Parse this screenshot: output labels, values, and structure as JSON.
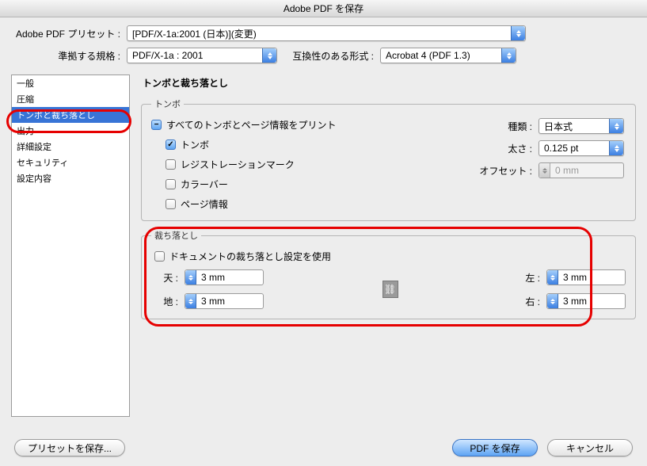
{
  "title": "Adobe PDF を保存",
  "header": {
    "presetLabel": "Adobe PDF プリセット :",
    "presetValue": "[PDF/X-1a:2001 (日本)](変更)",
    "standardLabel": "準拠する規格 :",
    "standardValue": "PDF/X-1a : 2001",
    "compatLabel": "互換性のある形式 :",
    "compatValue": "Acrobat 4 (PDF 1.3)"
  },
  "sidebar": {
    "items": [
      "一般",
      "圧縮",
      "トンボと裁ち落とし",
      "出力",
      "詳細設定",
      "セキュリティ",
      "設定内容"
    ],
    "selectedIndex": 2
  },
  "panel": {
    "heading": "トンボと裁ち落とし",
    "marks": {
      "legend": "トンボ",
      "printAll": "すべてのトンボとページ情報をプリント",
      "trim": "トンボ",
      "registration": "レジストレーションマーク",
      "colorBars": "カラーバー",
      "pageInfo": "ページ情報",
      "typeLabel": "種類 :",
      "typeValue": "日本式",
      "weightLabel": "太さ :",
      "weightValue": "0.125 pt",
      "offsetLabel": "オフセット :",
      "offsetValue": "0 mm"
    },
    "bleed": {
      "legend": "裁ち落とし",
      "useDoc": "ドキュメントの裁ち落とし設定を使用",
      "topLabel": "天 :",
      "bottomLabel": "地 :",
      "leftLabel": "左 :",
      "rightLabel": "右 :",
      "top": "3 mm",
      "bottom": "3 mm",
      "left": "3 mm",
      "right": "3 mm"
    }
  },
  "footer": {
    "savePreset": "プリセットを保存...",
    "savePDF": "PDF を保存",
    "cancel": "キャンセル"
  }
}
